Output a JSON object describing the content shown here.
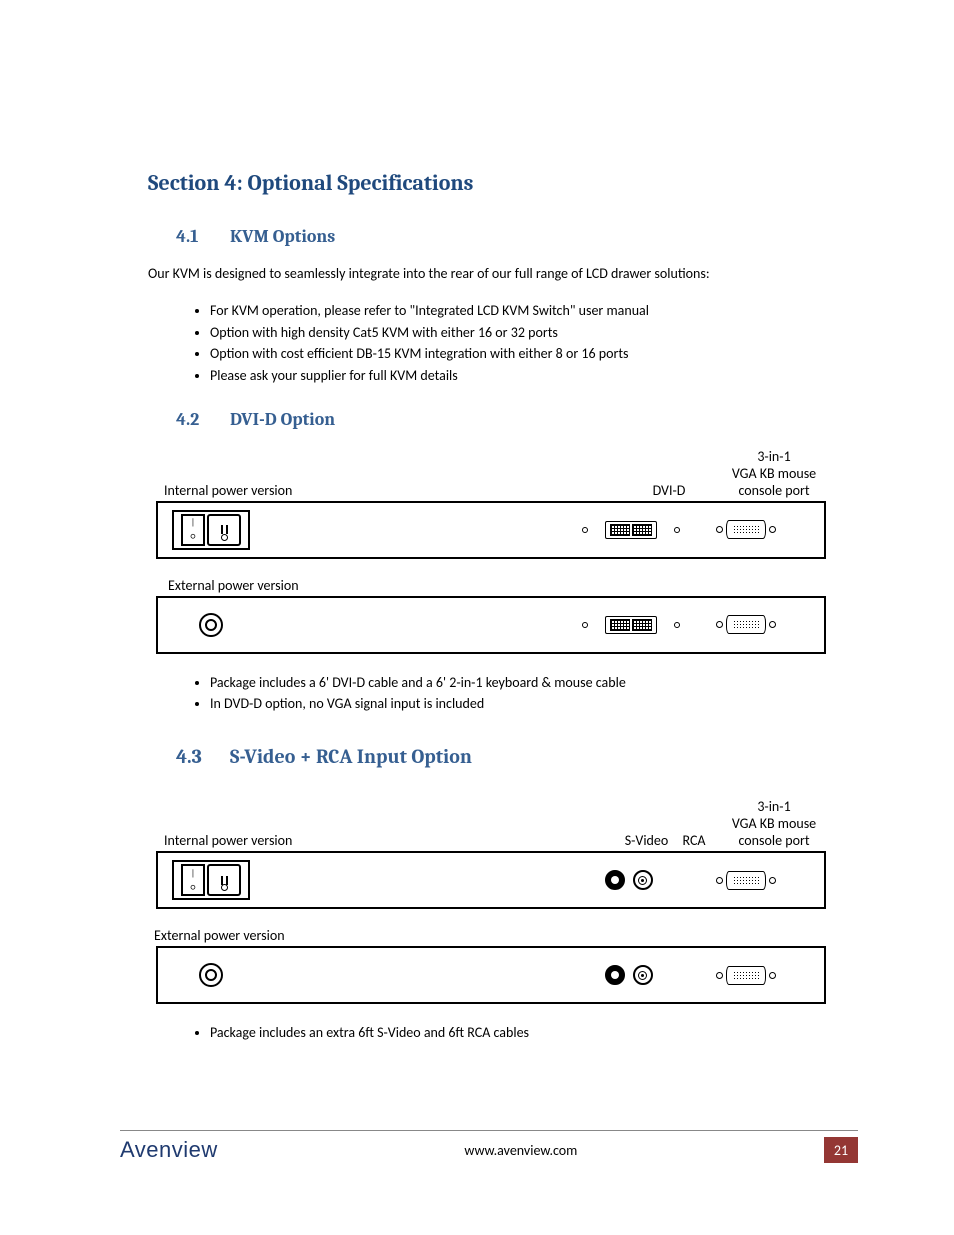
{
  "section": {
    "title": "Section 4: Optional Specifications"
  },
  "s41": {
    "num": "4.1",
    "title": "KVM Options",
    "intro": "Our KVM is designed to seamlessly integrate into the rear of our full range of LCD drawer solutions:",
    "bullets": [
      "For KVM operation, please refer to \"Integrated LCD KVM Switch\" user manual",
      "Option with high density Cat5 KVM with either 16 or 32 ports",
      "Option with cost efficient DB-15 KVM integration with either 8 or 16 ports",
      "Please ask your supplier for full KVM details"
    ]
  },
  "s42": {
    "num": "4.2",
    "title": "DVI-D Option",
    "labels": {
      "internal": "Internal power version",
      "external": "External power version",
      "dvid": "DVI-D",
      "console3": "3-in-1\nVGA KB mouse\nconsole port"
    },
    "bullets": [
      "Package includes a 6' DVI-D cable and a 6' 2-in-1 keyboard & mouse cable",
      "In DVD-D option, no VGA signal input is included"
    ]
  },
  "s43": {
    "num": "4.3",
    "title": "S-Video + RCA Input Option",
    "labels": {
      "internal": "Internal power version",
      "external": "External power version",
      "svideo": "S-Video",
      "rca": "RCA",
      "console3": "3-in-1\nVGA KB mouse\nconsole port"
    },
    "bullets": [
      "Package includes an extra 6ft S-Video and 6ft RCA cables"
    ]
  },
  "footer": {
    "brand": "Avenview",
    "url": "www.avenview.com",
    "page": "21"
  }
}
